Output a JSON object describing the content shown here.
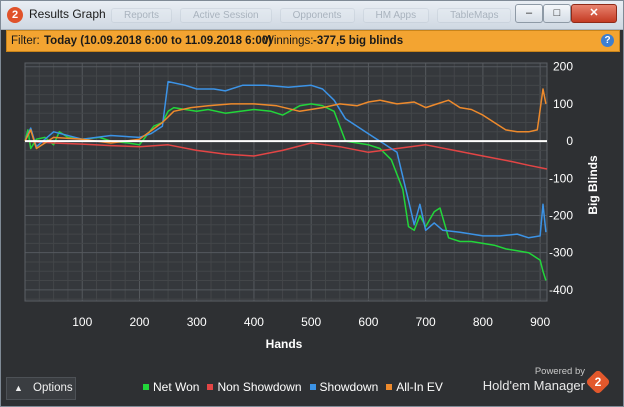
{
  "window": {
    "title": "Results Graph",
    "controls": {
      "minimize": "–",
      "maximize": "□",
      "close": "✕"
    }
  },
  "tabs": [
    "Reports",
    "Active Session",
    "Opponents",
    "HM Apps",
    "TableMaps"
  ],
  "filter": {
    "label": "Filter:",
    "value": "Today (10.09.2018 6:00 to 11.09.2018 6:00)",
    "winnings_label": "Winnings:",
    "winnings_value": "-377,5 big blinds",
    "help": "?"
  },
  "options_label": "Options",
  "brand": {
    "powered": "Powered by",
    "name": "Hold'em Manager",
    "logo": "2"
  },
  "colors": {
    "net_won": "#22d63a",
    "non_showdown": "#e34545",
    "showdown": "#3c93e6",
    "all_in_ev": "#ee8a2c",
    "background": "#2e3033",
    "zero_line": "#ffffff"
  },
  "chart_data": {
    "type": "line",
    "xlabel": "Hands",
    "ylabel": "Big Blinds",
    "xlim": [
      0,
      912
    ],
    "ylim": [
      -430,
      210
    ],
    "xticks": [
      100,
      200,
      300,
      400,
      500,
      600,
      700,
      800,
      900
    ],
    "yticks": [
      200,
      100,
      0,
      -100,
      -200,
      -300,
      -400
    ],
    "grid": true,
    "legend": "bottom",
    "series": [
      {
        "name": "Net Won",
        "color": "#22d63a",
        "x": [
          0,
          5,
          10,
          20,
          35,
          50,
          60,
          75,
          100,
          130,
          150,
          180,
          200,
          225,
          240,
          250,
          260,
          280,
          300,
          320,
          350,
          400,
          430,
          450,
          480,
          500,
          520,
          540,
          560,
          580,
          600,
          620,
          640,
          660,
          670,
          680,
          690,
          700,
          715,
          725,
          740,
          760,
          780,
          800,
          820,
          840,
          860,
          880,
          900,
          905,
          910
        ],
        "y": [
          0,
          30,
          -20,
          5,
          10,
          -10,
          25,
          10,
          5,
          10,
          0,
          -5,
          -10,
          40,
          50,
          80,
          90,
          85,
          80,
          85,
          75,
          85,
          80,
          70,
          95,
          100,
          95,
          80,
          0,
          -5,
          -10,
          -20,
          -50,
          -130,
          -230,
          -240,
          -200,
          -230,
          -190,
          -180,
          -260,
          -270,
          -270,
          -275,
          -280,
          -290,
          -295,
          -300,
          -320,
          -350,
          -375
        ]
      },
      {
        "name": "Non Showdown",
        "color": "#e34545",
        "x": [
          0,
          50,
          100,
          150,
          200,
          250,
          300,
          350,
          400,
          450,
          500,
          550,
          600,
          650,
          700,
          750,
          800,
          850,
          880,
          912
        ],
        "y": [
          0,
          -5,
          -8,
          -12,
          -15,
          -10,
          -25,
          -35,
          -40,
          -25,
          -5,
          -15,
          -30,
          -20,
          -10,
          -25,
          -40,
          -55,
          -65,
          -75
        ]
      },
      {
        "name": "Showdown",
        "color": "#3c93e6",
        "x": [
          0,
          10,
          20,
          50,
          100,
          150,
          200,
          220,
          240,
          250,
          280,
          300,
          330,
          350,
          380,
          420,
          460,
          500,
          520,
          540,
          560,
          600,
          650,
          670,
          680,
          690,
          700,
          715,
          730,
          760,
          800,
          830,
          860,
          880,
          900,
          905,
          910
        ],
        "y": [
          0,
          35,
          -15,
          25,
          5,
          15,
          10,
          20,
          40,
          160,
          150,
          140,
          140,
          135,
          150,
          150,
          145,
          150,
          140,
          110,
          60,
          20,
          -30,
          -160,
          -225,
          -170,
          -240,
          -220,
          -240,
          -245,
          -255,
          -255,
          -250,
          -260,
          -255,
          -170,
          -245
        ]
      },
      {
        "name": "All-In EV",
        "color": "#ee8a2c",
        "x": [
          0,
          10,
          20,
          50,
          100,
          150,
          200,
          240,
          260,
          290,
          320,
          360,
          400,
          440,
          480,
          520,
          550,
          580,
          600,
          620,
          650,
          680,
          700,
          720,
          740,
          760,
          780,
          800,
          820,
          840,
          860,
          880,
          895,
          905,
          910
        ],
        "y": [
          0,
          30,
          -20,
          10,
          5,
          -5,
          5,
          50,
          80,
          90,
          95,
          100,
          100,
          95,
          80,
          90,
          100,
          95,
          105,
          110,
          100,
          105,
          90,
          100,
          110,
          90,
          85,
          70,
          50,
          30,
          25,
          25,
          30,
          140,
          100
        ]
      }
    ]
  }
}
